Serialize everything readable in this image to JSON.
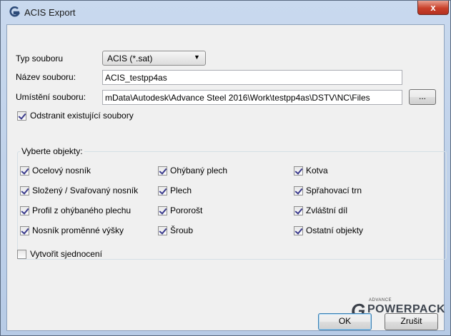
{
  "window": {
    "title": "ACIS Export",
    "close_glyph": "x"
  },
  "form": {
    "file_type_label": "Typ souboru",
    "file_type_value": "ACIS (*.sat)",
    "file_name_label": "Název souboru:",
    "file_name_value": "ACIS_testpp4as",
    "location_label": "Umístění souboru:",
    "location_value": "mData\\Autodesk\\Advance Steel 2016\\Work\\testpp4as\\DSTV\\NC\\Files",
    "browse_label": "...",
    "delete_existing_label": "Odstranit existující soubory",
    "delete_existing_checked": true
  },
  "objects": {
    "group_label": "Vyberte objekty:",
    "items": [
      {
        "label": "Ocelový nosník",
        "checked": true
      },
      {
        "label": "Ohýbaný plech",
        "checked": true
      },
      {
        "label": "Kotva",
        "checked": true
      },
      {
        "label": "Složený / Svařovaný nosník",
        "checked": true
      },
      {
        "label": "Plech",
        "checked": true
      },
      {
        "label": "Spřahovací trn",
        "checked": true
      },
      {
        "label": "Profil z ohýbaného plechu",
        "checked": true
      },
      {
        "label": "Pororošt",
        "checked": true
      },
      {
        "label": "Zvláštní díl",
        "checked": true
      },
      {
        "label": "Nosník proměnné výšky",
        "checked": true
      },
      {
        "label": "Šroub",
        "checked": true
      },
      {
        "label": "Ostatní objekty",
        "checked": true
      }
    ]
  },
  "union": {
    "label": "Vytvořit sjednocení",
    "checked": false
  },
  "logo": {
    "small": "ADVANCE",
    "big": "POWERPACK",
    "mark": "G"
  },
  "buttons": {
    "ok": "OK",
    "cancel": "Zrušit"
  },
  "colors": {
    "title_icon": "#2c4a78",
    "close_button": "#c9402a"
  }
}
